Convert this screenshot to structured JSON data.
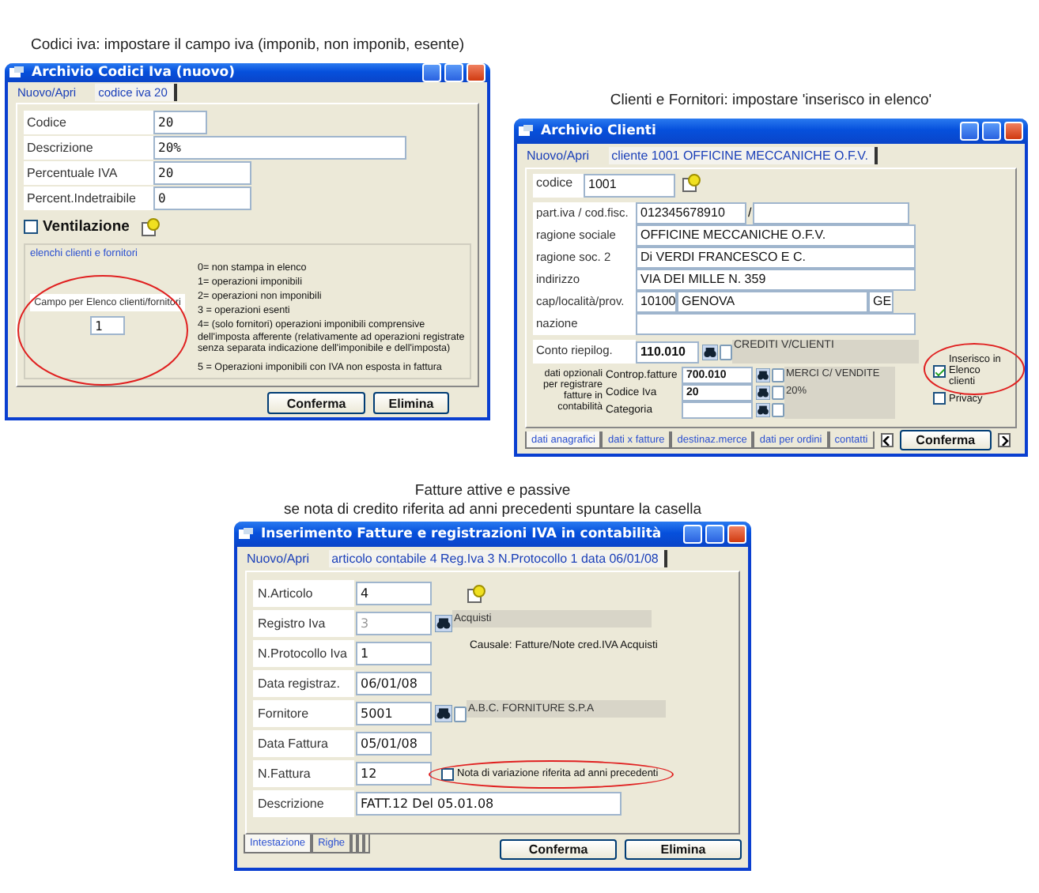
{
  "codici_iva": {
    "caption": "Codici iva: impostare il campo iva (imponib, non imponib, esente)",
    "title": "Archivio Codici Iva (nuovo)",
    "tabs": [
      {
        "label": "Nuovo/Apri",
        "selected": false
      },
      {
        "label": "codice iva 20",
        "selected": true
      }
    ],
    "fields": [
      {
        "label": "Codice",
        "value": "20"
      },
      {
        "label": "Descrizione",
        "value": "20%"
      },
      {
        "label": "Percentuale IVA",
        "value": "20"
      },
      {
        "label": "Percent.Indetraibile",
        "value": "0"
      }
    ],
    "ventilazione": {
      "label": "Ventilazione",
      "checked": false
    },
    "group": {
      "title": "elenchi clienti e fornitori",
      "field_label": "Campo per Elenco clienti/fornitori",
      "value": "1",
      "circled": true,
      "legend": [
        "0= non stampa in elenco",
        "1= operazioni imponibili",
        "2= operazioni non imponibili",
        "3 = operazioni esenti",
        "4= (solo fornitori) operazioni imponibili comprensive dell'imposta afferente (relativamente ad operazioni registrate senza separata indicazione dell'imponibile e dell'imposta)",
        "5 = Operazioni imponibili con IVA non esposta in fattura"
      ]
    },
    "buttons": [
      "Conferma",
      "Elimina"
    ]
  },
  "clienti": {
    "caption": "Clienti e Fornitori: impostare 'inserisco in elenco'",
    "title": "Archivio Clienti",
    "tabs": [
      {
        "label": "Nuovo/Apri",
        "selected": false
      },
      {
        "label": "cliente 1001 OFFICINE MECCANICHE O.F.V.",
        "selected": true
      }
    ],
    "codice": {
      "label": "codice",
      "value": "1001"
    },
    "piva": {
      "label": "part.iva / cod.fisc.",
      "value": "012345678910",
      "separator": "/"
    },
    "rows": [
      {
        "label": "ragione sociale",
        "value": "OFFICINE MECCANICHE O.F.V."
      },
      {
        "label": "ragione soc. 2",
        "value": "Di VERDI FRANCESCO E C."
      },
      {
        "label": "indirizzo",
        "value": "VIA DEI MILLE N. 359"
      }
    ],
    "cap": {
      "label": "cap/località/prov.",
      "cap": "10100",
      "city": "GENOVA",
      "prov": "GE"
    },
    "nazione": {
      "label": "nazione"
    },
    "conto": {
      "label": "Conto riepilog.",
      "value": "110.010",
      "desc": "CREDITI V/CLIENTI"
    },
    "optional_note": "dati opzionali per registrare fatture in contabilità",
    "optional": [
      {
        "label": "Controp.fatture",
        "value": "700.010",
        "desc": "MERCI C/ VENDITE"
      },
      {
        "label": "Codice Iva",
        "value": "20",
        "desc": "20%"
      },
      {
        "label": "Categoria"
      }
    ],
    "checks": [
      {
        "label": "Inserisco in Elenco clienti",
        "checked": true,
        "circled": true
      },
      {
        "label": "Privacy",
        "checked": false,
        "circled": false
      }
    ],
    "bottom_tabs": [
      {
        "label": "dati anagrafici",
        "selected": true
      },
      {
        "label": "dati x fatture",
        "selected": false
      },
      {
        "label": "destinaz.merce",
        "selected": false
      },
      {
        "label": "dati per ordini",
        "selected": false
      },
      {
        "label": "contatti",
        "selected": false
      }
    ],
    "button": "Conferma"
  },
  "fatture": {
    "caption": [
      "Fatture attive e passive",
      "se nota di credito riferita ad anni precedenti spuntare la casella"
    ],
    "title": "Inserimento Fatture e registrazioni IVA in contabilità",
    "tabs": [
      {
        "label": "Nuovo/Apri",
        "selected": false
      },
      {
        "label": "articolo contabile 4 Reg.Iva 3 N.Protocollo 1 data 06/01/08",
        "selected": true
      }
    ],
    "fields": [
      {
        "kind": "text",
        "label": "N.Articolo",
        "value": "4",
        "disabled": false,
        "help": true
      },
      {
        "kind": "lookup",
        "label": "Registro Iva",
        "value": "3",
        "disabled": true,
        "desc": "Acquisti",
        "more": false
      },
      {
        "kind": "text",
        "label": "N.Protocollo Iva",
        "value": "1",
        "disabled": false,
        "note": "Causale: Fatture/Note cred.IVA Acquisti"
      },
      {
        "kind": "text",
        "label": "Data registraz.",
        "value": "06/01/08",
        "disabled": false
      },
      {
        "kind": "lookup",
        "label": "Fornitore",
        "value": "5001",
        "disabled": false,
        "desc": "A.B.C. FORNITURE S.P.A",
        "more": true
      },
      {
        "kind": "text",
        "label": "Data Fattura",
        "value": "05/01/08",
        "disabled": false
      },
      {
        "kind": "text",
        "label": "N.Fattura",
        "value": "12",
        "disabled": false,
        "check": {
          "label": "Nota di variazione riferita ad anni precedenti",
          "checked": false,
          "circled": true
        }
      },
      {
        "kind": "wide",
        "label": "Descrizione",
        "value": "FATT.12 Del 05.01.08",
        "disabled": false
      }
    ],
    "bottom_tabs": [
      {
        "label": "Intestazione",
        "selected": true
      },
      {
        "label": "Righe",
        "selected": false
      }
    ],
    "buttons": [
      "Conferma",
      "Elimina"
    ]
  }
}
